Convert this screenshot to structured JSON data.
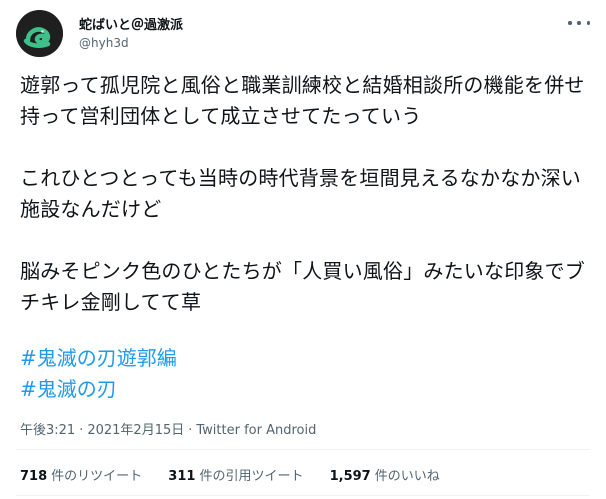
{
  "author": {
    "display_name": "蛇ばいと＠過激派",
    "handle": "@hyh3d",
    "avatar_icon": "snake-avatar-icon"
  },
  "menu": {
    "icon": "more-icon"
  },
  "tweet": {
    "paragraphs": [
      "遊郭って孤児院と風俗と職業訓練校と結婚相談所の機能を併せ持って営利団体として成立させてたっていう",
      "これひとつとっても当時の時代背景を垣間見えるなかなか深い施設なんだけど",
      "脳みそピンク色のひとたちが「人買い風俗」みたいな印象でブチキレ金剛してて草"
    ],
    "hashtags": [
      "#鬼滅の刃遊郭編",
      "#鬼滅の刃"
    ]
  },
  "meta": {
    "time": "午後3:21",
    "date": "2021年2月15日",
    "source": "Twitter for Android",
    "separator": "·"
  },
  "stats": {
    "retweets_count": "718",
    "retweets_label": "件のリツイート",
    "quotes_count": "311",
    "quotes_label": "件の引用ツイート",
    "likes_count": "1,597",
    "likes_label": "件のいいね"
  },
  "colors": {
    "link": "#1d9bf0",
    "text": "#0f1419",
    "secondary": "#536471",
    "divider": "#eff3f4"
  }
}
